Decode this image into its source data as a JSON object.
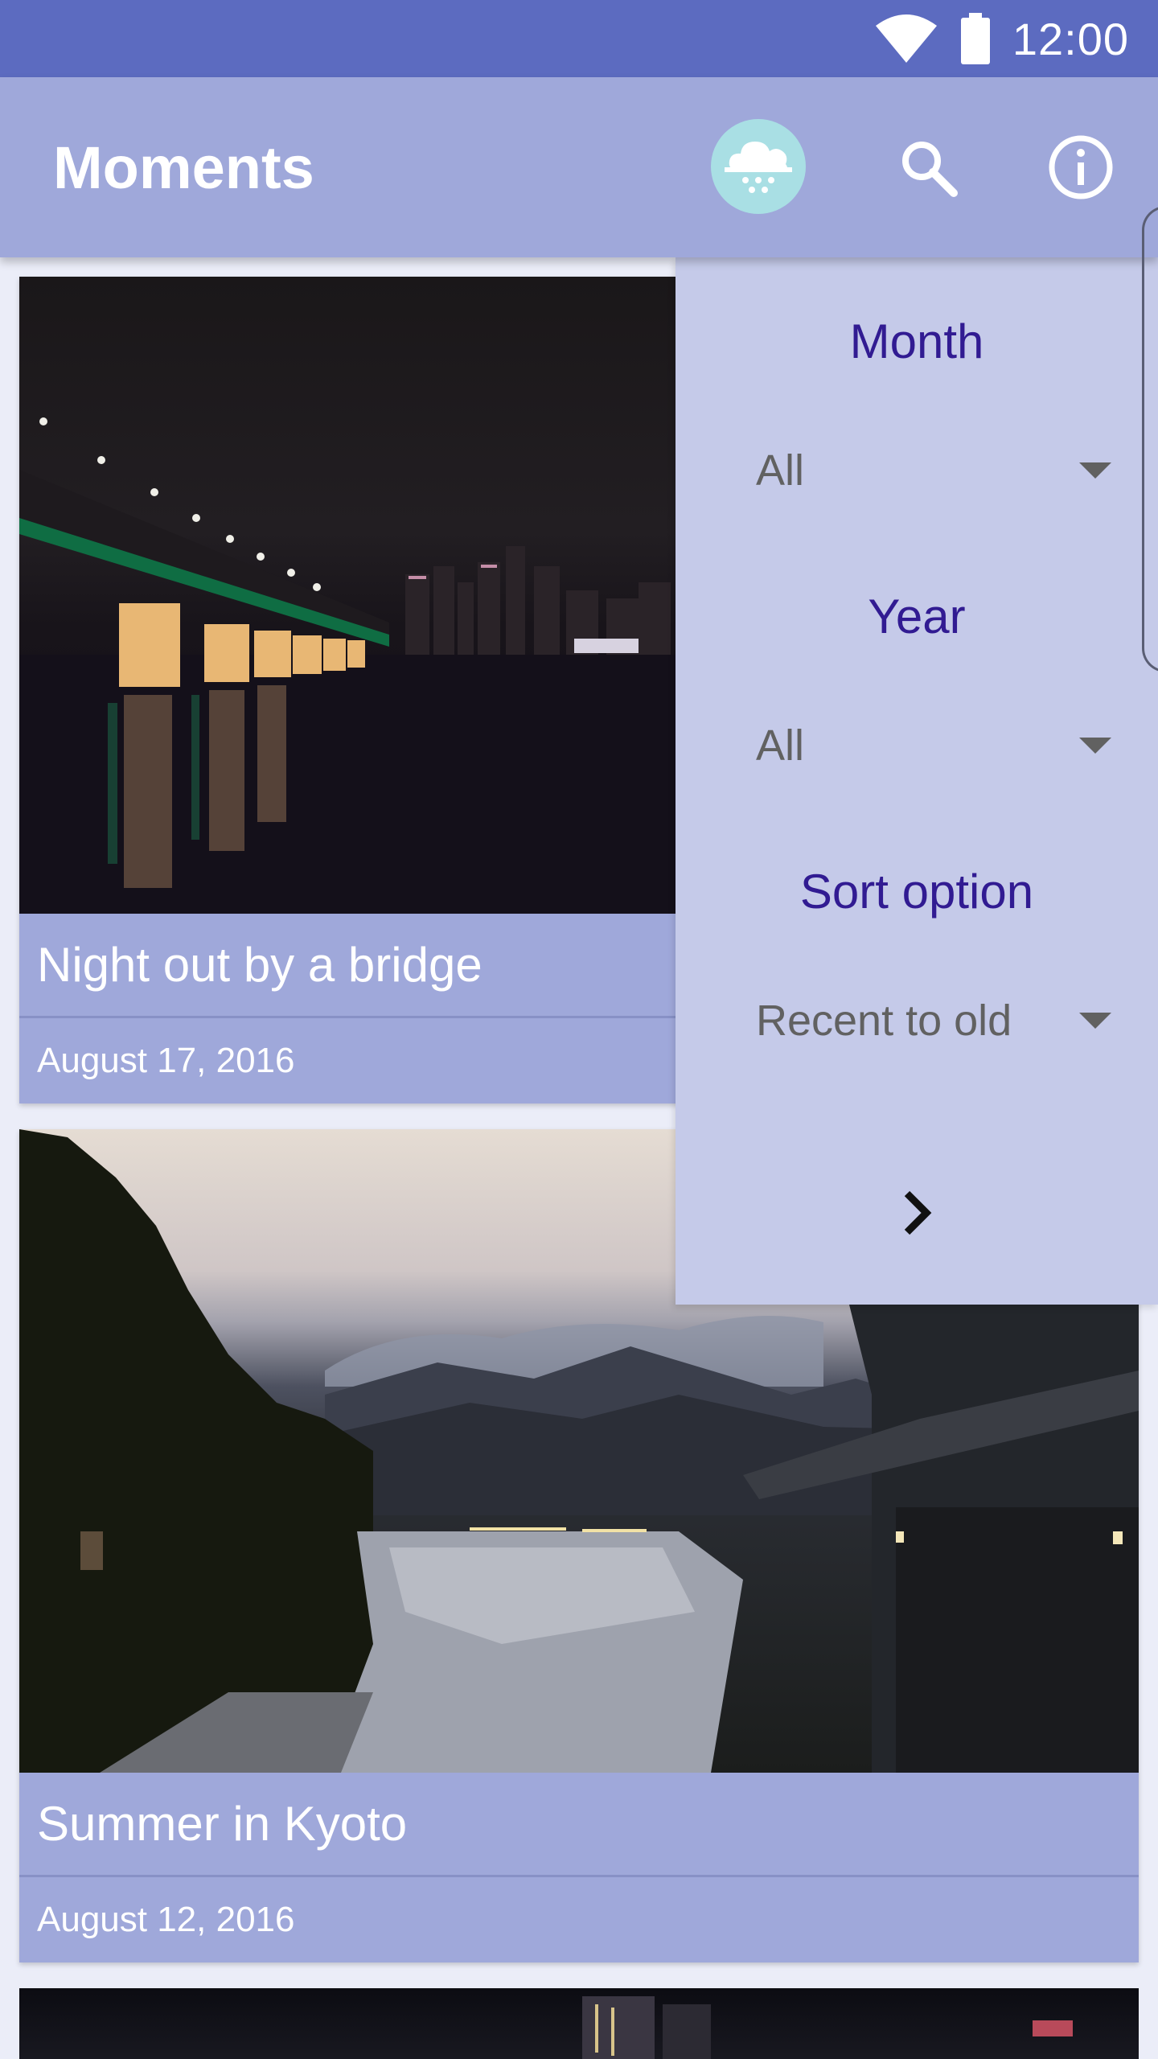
{
  "status_bar": {
    "time": "12:00",
    "icons": [
      "wifi-icon",
      "battery-icon"
    ]
  },
  "app_bar": {
    "title": "Moments",
    "actions": [
      "cloud-rain-icon",
      "search-icon",
      "info-icon"
    ]
  },
  "filter_panel": {
    "month": {
      "label": "Month",
      "value": "All"
    },
    "year": {
      "label": "Year",
      "value": "All"
    },
    "sort": {
      "label": "Sort option",
      "value": "Recent to old"
    },
    "next_icon": "chevron-right-icon"
  },
  "moments": [
    {
      "title": "Night out by a bridge",
      "date": "August 17, 2016"
    },
    {
      "title": "Summer in Kyoto",
      "date": "August 12, 2016"
    }
  ],
  "colors": {
    "status_bar": "#5c6bc0",
    "app_bar": "#9fa8da",
    "panel": "#c5cae9",
    "panel_label": "#311b92",
    "weather_badge": "#a9dfe4"
  }
}
